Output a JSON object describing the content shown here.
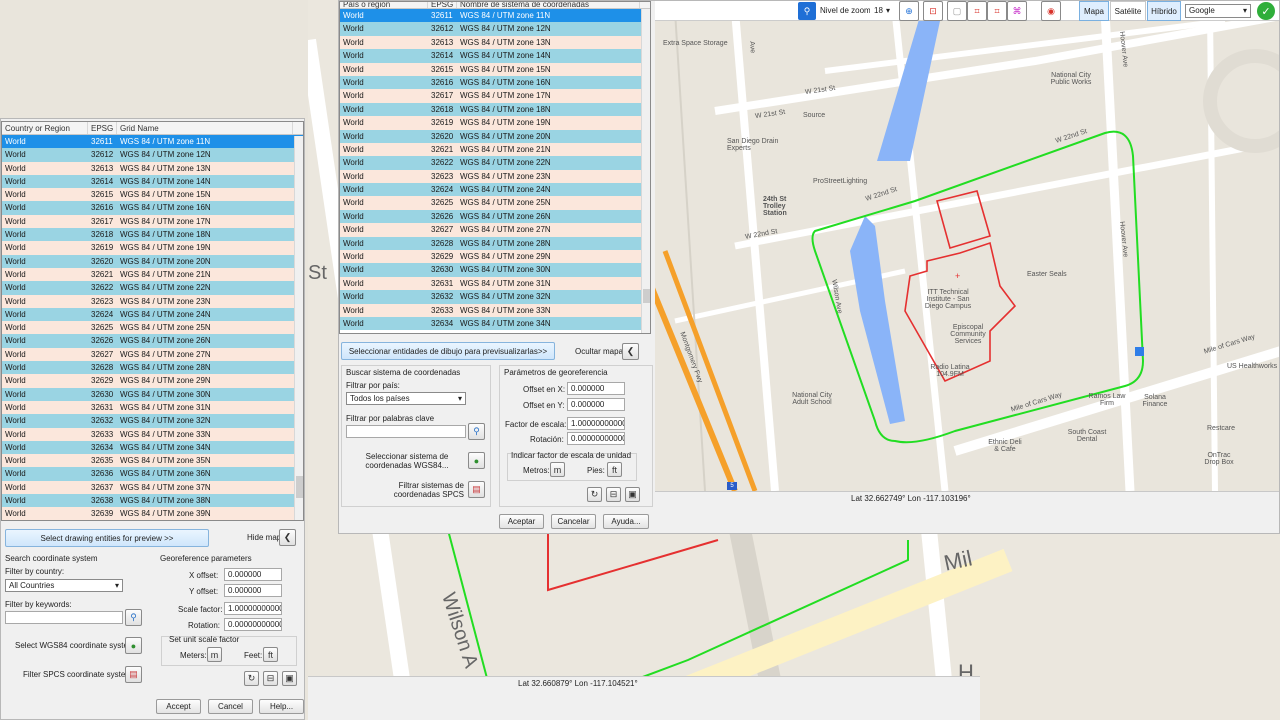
{
  "map_bg": {
    "street_labels": [
      "Wilson A",
      "Mil",
      "St",
      "H"
    ],
    "status": "Lat 32.660879°  Lon -117.104521°"
  },
  "left_dialog": {
    "columns": [
      "Country or Region",
      "EPSG",
      "Grid Name"
    ],
    "rows": [
      [
        "World",
        "32611",
        "WGS 84 / UTM zone 11N"
      ],
      [
        "World",
        "32612",
        "WGS 84 / UTM zone 12N"
      ],
      [
        "World",
        "32613",
        "WGS 84 / UTM zone 13N"
      ],
      [
        "World",
        "32614",
        "WGS 84 / UTM zone 14N"
      ],
      [
        "World",
        "32615",
        "WGS 84 / UTM zone 15N"
      ],
      [
        "World",
        "32616",
        "WGS 84 / UTM zone 16N"
      ],
      [
        "World",
        "32617",
        "WGS 84 / UTM zone 17N"
      ],
      [
        "World",
        "32618",
        "WGS 84 / UTM zone 18N"
      ],
      [
        "World",
        "32619",
        "WGS 84 / UTM zone 19N"
      ],
      [
        "World",
        "32620",
        "WGS 84 / UTM zone 20N"
      ],
      [
        "World",
        "32621",
        "WGS 84 / UTM zone 21N"
      ],
      [
        "World",
        "32622",
        "WGS 84 / UTM zone 22N"
      ],
      [
        "World",
        "32623",
        "WGS 84 / UTM zone 23N"
      ],
      [
        "World",
        "32624",
        "WGS 84 / UTM zone 24N"
      ],
      [
        "World",
        "32625",
        "WGS 84 / UTM zone 25N"
      ],
      [
        "World",
        "32626",
        "WGS 84 / UTM zone 26N"
      ],
      [
        "World",
        "32627",
        "WGS 84 / UTM zone 27N"
      ],
      [
        "World",
        "32628",
        "WGS 84 / UTM zone 28N"
      ],
      [
        "World",
        "32629",
        "WGS 84 / UTM zone 29N"
      ],
      [
        "World",
        "32630",
        "WGS 84 / UTM zone 30N"
      ],
      [
        "World",
        "32631",
        "WGS 84 / UTM zone 31N"
      ],
      [
        "World",
        "32632",
        "WGS 84 / UTM zone 32N"
      ],
      [
        "World",
        "32633",
        "WGS 84 / UTM zone 33N"
      ],
      [
        "World",
        "32634",
        "WGS 84 / UTM zone 34N"
      ],
      [
        "World",
        "32635",
        "WGS 84 / UTM zone 35N"
      ],
      [
        "World",
        "32636",
        "WGS 84 / UTM zone 36N"
      ],
      [
        "World",
        "32637",
        "WGS 84 / UTM zone 37N"
      ],
      [
        "World",
        "32638",
        "WGS 84 / UTM zone 38N"
      ],
      [
        "World",
        "32639",
        "WGS 84 / UTM zone 39N"
      ]
    ],
    "preview_button": "Select drawing entities for preview >>",
    "hide_map": "Hide map",
    "search_title": "Search coordinate system",
    "filter_country_label": "Filter by country:",
    "filter_country_value": "All Countries",
    "filter_keywords_label": "Filter by keywords:",
    "select_wgs84": "Select WGS84 coordinate system...",
    "filter_spcs": "Filter SPCS coordinate systems",
    "geo_title": "Georeference parameters",
    "x_offset_label": "X offset:",
    "x_offset_value": "0.000000",
    "y_offset_label": "Y offset:",
    "y_offset_value": "0.000000",
    "scale_label": "Scale factor:",
    "scale_value": "1.000000000000",
    "rotation_label": "Rotation:",
    "rotation_value": "0.000000000000",
    "unit_scale_title": "Set unit scale factor",
    "meters_label": "Meters:",
    "feet_label": "Feet:",
    "accept": "Accept",
    "cancel": "Cancel",
    "help": "Help..."
  },
  "right_dialog": {
    "columns": [
      "País o región",
      "EPSG",
      "Nombre de sistema de coordenadas"
    ],
    "rows": [
      [
        "World",
        "32611",
        "WGS 84 / UTM zone 11N"
      ],
      [
        "World",
        "32612",
        "WGS 84 / UTM zone 12N"
      ],
      [
        "World",
        "32613",
        "WGS 84 / UTM zone 13N"
      ],
      [
        "World",
        "32614",
        "WGS 84 / UTM zone 14N"
      ],
      [
        "World",
        "32615",
        "WGS 84 / UTM zone 15N"
      ],
      [
        "World",
        "32616",
        "WGS 84 / UTM zone 16N"
      ],
      [
        "World",
        "32617",
        "WGS 84 / UTM zone 17N"
      ],
      [
        "World",
        "32618",
        "WGS 84 / UTM zone 18N"
      ],
      [
        "World",
        "32619",
        "WGS 84 / UTM zone 19N"
      ],
      [
        "World",
        "32620",
        "WGS 84 / UTM zone 20N"
      ],
      [
        "World",
        "32621",
        "WGS 84 / UTM zone 21N"
      ],
      [
        "World",
        "32622",
        "WGS 84 / UTM zone 22N"
      ],
      [
        "World",
        "32623",
        "WGS 84 / UTM zone 23N"
      ],
      [
        "World",
        "32624",
        "WGS 84 / UTM zone 24N"
      ],
      [
        "World",
        "32625",
        "WGS 84 / UTM zone 25N"
      ],
      [
        "World",
        "32626",
        "WGS 84 / UTM zone 26N"
      ],
      [
        "World",
        "32627",
        "WGS 84 / UTM zone 27N"
      ],
      [
        "World",
        "32628",
        "WGS 84 / UTM zone 28N"
      ],
      [
        "World",
        "32629",
        "WGS 84 / UTM zone 29N"
      ],
      [
        "World",
        "32630",
        "WGS 84 / UTM zone 30N"
      ],
      [
        "World",
        "32631",
        "WGS 84 / UTM zone 31N"
      ],
      [
        "World",
        "32632",
        "WGS 84 / UTM zone 32N"
      ],
      [
        "World",
        "32633",
        "WGS 84 / UTM zone 33N"
      ],
      [
        "World",
        "32634",
        "WGS 84 / UTM zone 34N"
      ]
    ],
    "preview_button": "Seleccionar entidades de dibujo para previsualizarlas>>",
    "hide_map": "Ocultar mapa",
    "search_title": "Buscar sistema de coordenadas",
    "filter_country_label": "Filtrar por país:",
    "filter_country_value": "Todos los países",
    "filter_keywords_label": "Filtrar por palabras clave",
    "select_wgs84": "Seleccionar sistema de coordenadas WGS84...",
    "filter_spcs": "Filtrar sistemas de coordenadas SPCS",
    "geo_title": "Parámetros de georeferencia",
    "x_offset_label": "Offset en X:",
    "x_offset_value": "0.000000",
    "y_offset_label": "Offset en Y:",
    "y_offset_value": "0.000000",
    "scale_label": "Factor de escala:",
    "scale_value": "1.000000000000",
    "rotation_label": "Rotación:",
    "rotation_value": "0.000000000000",
    "unit_scale_title": "Indicar factor de escala de unidad",
    "meters_label": "Metros:",
    "feet_label": "Pies:",
    "accept": "Aceptar",
    "cancel": "Cancelar",
    "help": "Ayuda...",
    "status": "Lat 32.662749°  Lon -117.103196°"
  },
  "map_toolbar": {
    "zoom_label": "Nivel de zoom:",
    "zoom_value": "18",
    "map_btn": "Mapa",
    "satellite_btn": "Satélite",
    "hybrid_btn": "Híbrido",
    "provider": "Google"
  },
  "map_labels": {
    "extra_space": "Extra Space Storage",
    "w21": "W 21st St",
    "w21b": "W 21st St",
    "source": "Source",
    "sd_drain": "San Diego Drain Experts",
    "prostreet": "ProStreetLighting",
    "trolley": "24th St Trolley Station",
    "w22": "W 22nd St",
    "w22b": "W 22nd St",
    "w22c": "W 22nd St",
    "national_city_pw": "National City Public Works",
    "itt": "ITT Technical Institute - San Diego Campus",
    "episcopal": "Episcopal Community Services",
    "radio": "Radio Latina 104.9FM",
    "easter": "Easter Seals",
    "adult_school": "National City Adult School",
    "mile_of_cars": "Mile of Cars Way",
    "mile_of_cars_b": "Mile of Cars Way",
    "ramos": "Ramos Law Firm",
    "solana": "Solana Finance",
    "us_health": "US Healthworks",
    "south_coast": "South Coast Dental",
    "restcare": "Restcare",
    "ethnic": "Ethnic Deli & Cafe",
    "ontrac": "OnTrac Drop Box",
    "montgomery": "Montgomery Fwy",
    "hoover": "Hoover Ave",
    "hoover2": "Hoover Ave",
    "wilson": "Wilson Ave",
    "ave": "Ave",
    "fwy_shield": "5"
  },
  "colors": {
    "row_odd": "#fbe7dc",
    "row_even": "#9ad4e3",
    "row_selected": "#1e90e8",
    "boundary_green": "#22dd22",
    "building_red": "#e53030",
    "water": "#8ab4f8",
    "freeway": "#f5a02a"
  }
}
